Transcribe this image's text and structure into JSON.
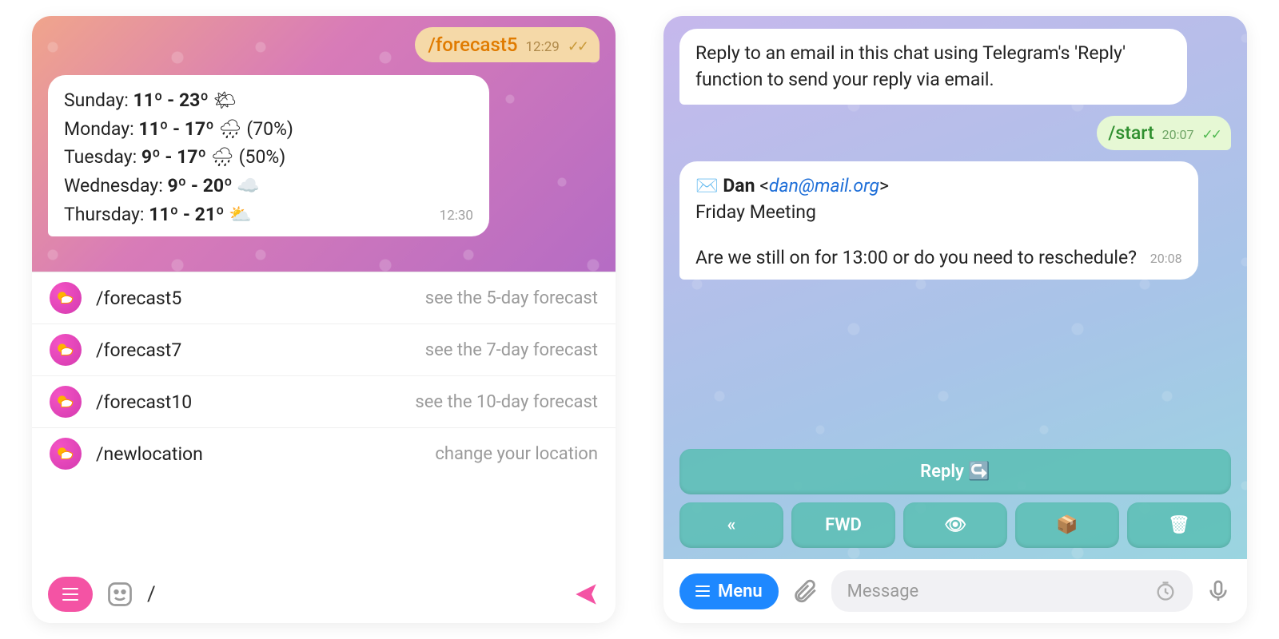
{
  "left": {
    "outgoing": {
      "text": "/forecast5",
      "time": "12:29"
    },
    "forecast": {
      "rows": [
        {
          "day": "Sunday:",
          "range": "11º - 23º",
          "icon": "🌤",
          "extra": ""
        },
        {
          "day": "Monday:",
          "range": "11º - 17º",
          "icon": "🌧",
          "extra": "(70%)"
        },
        {
          "day": "Tuesday:",
          "range": "9º - 17º",
          "icon": "🌧",
          "extra": "(50%)"
        },
        {
          "day": "Wednesday:",
          "range": "9º - 20º",
          "icon": "☁️",
          "extra": ""
        },
        {
          "day": "Thursday:",
          "range": "11º - 21º",
          "icon": "⛅",
          "extra": ""
        }
      ],
      "time": "12:30"
    },
    "commands": [
      {
        "name": "/forecast5",
        "desc": "see the 5-day forecast"
      },
      {
        "name": "/forecast7",
        "desc": "see the 7-day forecast"
      },
      {
        "name": "/forecast10",
        "desc": "see the 10-day forecast"
      },
      {
        "name": "/newlocation",
        "desc": "change your location"
      }
    ],
    "input_value": "/"
  },
  "right": {
    "intro": "Reply to an email in this chat using Telegram's 'Reply' function to send your reply via email.",
    "outgoing": {
      "text": "/start",
      "time": "20:07"
    },
    "email": {
      "icon": "✉️",
      "from_name": "Dan",
      "from_email": "dan@mail.org",
      "subject": "Friday Meeting",
      "body": "Are we still on for 13:00 or do you need to reschedule?",
      "time": "20:08"
    },
    "keyboard": {
      "reply": "Reply ↪️",
      "row2": [
        "«",
        "FWD",
        "👁",
        "📦",
        "🗑"
      ]
    },
    "menu_label": "Menu",
    "input_placeholder": "Message"
  }
}
